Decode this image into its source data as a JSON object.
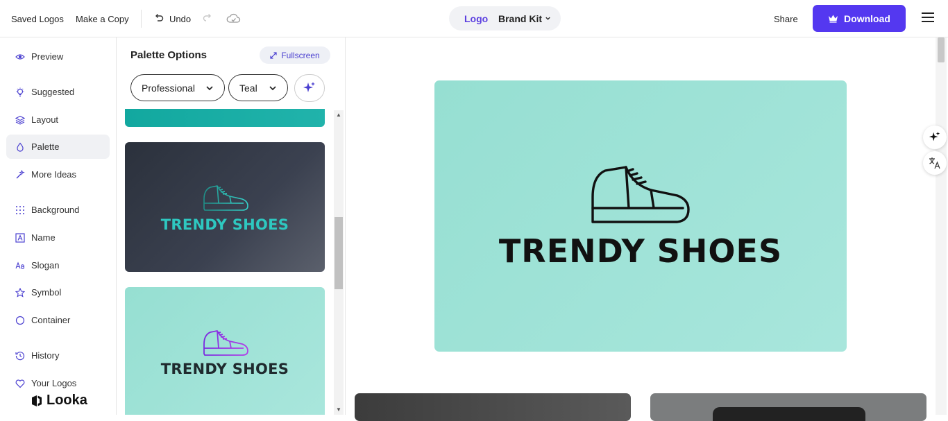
{
  "topbar": {
    "saved_logos": "Saved Logos",
    "make_copy": "Make a Copy",
    "undo": "Undo",
    "tab_logo": "Logo",
    "tab_brand_kit": "Brand Kit",
    "share": "Share",
    "download": "Download"
  },
  "sidebar": {
    "items": [
      {
        "label": "Preview",
        "icon": "eye-icon"
      },
      {
        "label": "Suggested",
        "icon": "lightbulb-icon"
      },
      {
        "label": "Layout",
        "icon": "layers-icon"
      },
      {
        "label": "Palette",
        "icon": "droplet-icon"
      },
      {
        "label": "More Ideas",
        "icon": "magic-wand-icon"
      },
      {
        "label": "Background",
        "icon": "grid-dots-icon"
      },
      {
        "label": "Name",
        "icon": "letter-a-box-icon"
      },
      {
        "label": "Slogan",
        "icon": "text-aa-icon"
      },
      {
        "label": "Symbol",
        "icon": "star-icon"
      },
      {
        "label": "Container",
        "icon": "circle-icon"
      },
      {
        "label": "History",
        "icon": "history-icon"
      },
      {
        "label": "Your Logos",
        "icon": "heart-icon"
      }
    ],
    "active": "Palette",
    "brand": "Looka"
  },
  "palette_panel": {
    "title": "Palette Options",
    "fullscreen": "Fullscreen",
    "style_select": "Professional",
    "color_select": "Teal",
    "cards": [
      {
        "text": "TRENDY SHOES",
        "background": "#2f3541",
        "text_color": "#2ec8c0"
      },
      {
        "text": "TRENDY SHOES",
        "background": "#a2e3d8",
        "text_color": "#1f2a2e",
        "icon_color": "#8a2be2"
      }
    ]
  },
  "preview": {
    "logo_text": "TRENDY SHOES",
    "background": "#a0e2d6",
    "text_color": "#111111"
  },
  "colors": {
    "accent": "#5438f0",
    "teal": "#14aaa1"
  }
}
